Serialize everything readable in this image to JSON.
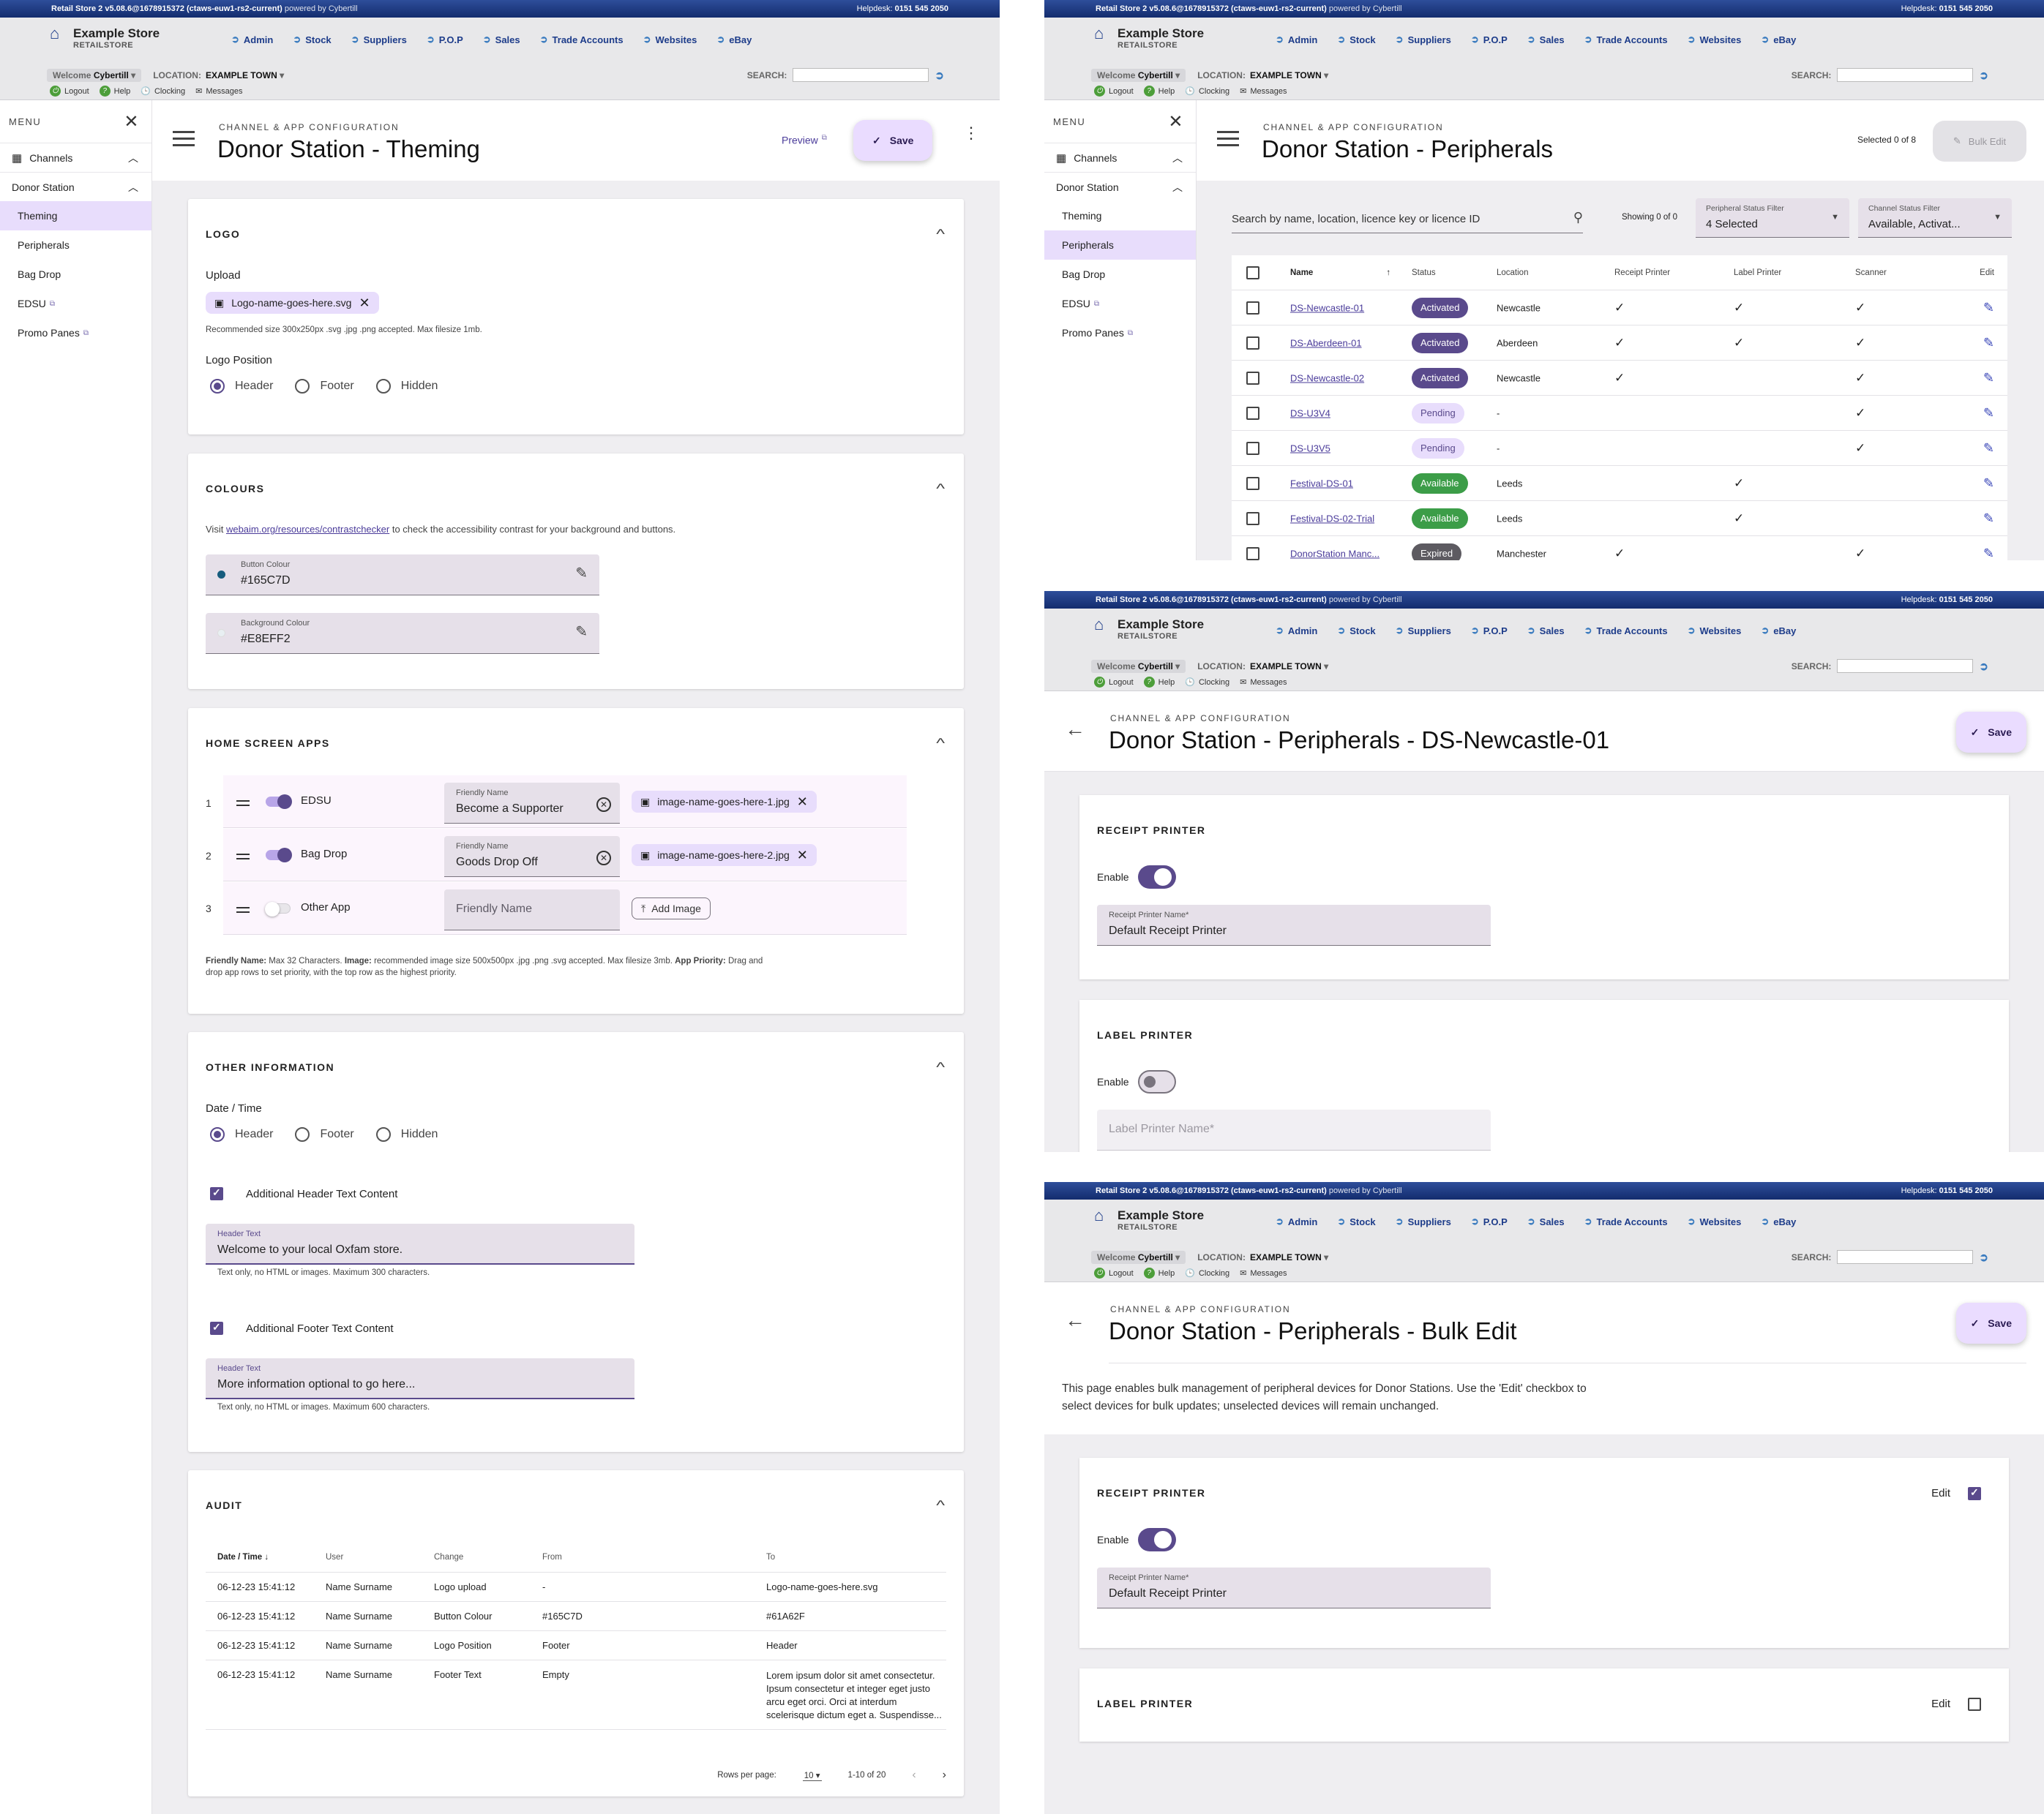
{
  "legacy": {
    "version": "Retail Store 2 v5.08.6@1678915372 (ctaws-euw1-rs2-current)",
    "powered": "powered by Cybertill",
    "helpdesk_label": "Helpdesk:",
    "helpdesk": "0151 545 2050",
    "store": "Example Store",
    "store_sub": "RETAILSTORE",
    "nav": [
      "Admin",
      "Stock",
      "Suppliers",
      "P.O.P",
      "Sales",
      "Trade Accounts",
      "Websites",
      "eBay"
    ],
    "welcome": "Welcome",
    "user": "Cybertill",
    "location_label": "LOCATION:",
    "location": "EXAMPLE TOWN",
    "search_label": "SEARCH:",
    "links": [
      "Logout",
      "Help",
      "Clocking",
      "Messages"
    ]
  },
  "menu": {
    "title": "MENU",
    "channels": "Channels",
    "donor_station": "Donor Station",
    "items": [
      "Theming",
      "Peripherals",
      "Bag Drop",
      "EDSU",
      "Promo Panes"
    ]
  },
  "common": {
    "kicker": "CHANNEL & APP CONFIGURATION",
    "save": "Save",
    "preview": "Preview"
  },
  "theming": {
    "title": "Donor Station - Theming",
    "logo": {
      "heading": "LOGO",
      "upload_label": "Upload",
      "file": "Logo-name-goes-here.svg",
      "hint": "Recommended size 300x250px .svg .jpg .png accepted. Max filesize 1mb.",
      "position_label": "Logo Position",
      "options": [
        "Header",
        "Footer",
        "Hidden"
      ],
      "selected": "Header"
    },
    "colours": {
      "heading": "COLOURS",
      "visit": "Visit",
      "link": "webaim.org/resources/contrastchecker",
      "visit_rest": "to check the accessibility contrast for your background and buttons.",
      "button_label": "Button Colour",
      "button_value": "#165C7D",
      "bg_label": "Background Colour",
      "bg_value": "#E8EFF2"
    },
    "apps": {
      "heading": "HOME SCREEN APPS",
      "friendly_label": "Friendly Name",
      "rows": [
        {
          "num": "1",
          "name": "EDSU",
          "friendly": "Become a Supporter",
          "image": "image-name-goes-here-1.jpg",
          "enabled": true
        },
        {
          "num": "2",
          "name": "Bag Drop",
          "friendly": "Goods Drop Off",
          "image": "image-name-goes-here-2.jpg",
          "enabled": true
        },
        {
          "num": "3",
          "name": "Other App",
          "friendly_placeholder": "Friendly Name",
          "add_image": "Add Image",
          "enabled": false
        }
      ],
      "note_b1": "Friendly Name:",
      "note_t1": " Max 32 Characters. ",
      "note_b2": "Image:",
      "note_t2": " recommended image size 500x500px .jpg .png .svg accepted. Max filesize 3mb. ",
      "note_b3": "App Priority:",
      "note_t3": " Drag and",
      "note_line2": "drop app rows to set priority, with the top row as the highest priority."
    },
    "other": {
      "heading": "OTHER INFORMATION",
      "datetime_label": "Date / Time",
      "options": [
        "Header",
        "Footer",
        "Hidden"
      ],
      "header_check": "Additional Header Text Content",
      "header_field_label": "Header Text",
      "header_value": "Welcome to your local Oxfam store.",
      "header_hint": "Text only, no HTML or images. Maximum 300 characters.",
      "footer_check": "Additional Footer Text Content",
      "footer_field_label": "Header Text",
      "footer_value": "More information optional to go here...",
      "footer_hint": "Text only, no HTML or images. Maximum 600 characters."
    },
    "audit": {
      "heading": "AUDIT",
      "columns": [
        "Date / Time",
        "User",
        "Change",
        "From",
        "To"
      ],
      "rows": [
        [
          "06-12-23 15:41:12",
          "Name Surname",
          "Logo upload",
          "-",
          "Logo-name-goes-here.svg"
        ],
        [
          "06-12-23 15:41:12",
          "Name Surname",
          "Button Colour",
          "#165C7D",
          "#61A62F"
        ],
        [
          "06-12-23 15:41:12",
          "Name Surname",
          "Logo Position",
          "Footer",
          "Header"
        ],
        [
          "06-12-23 15:41:12",
          "Name Surname",
          "Footer Text",
          "Empty",
          "Lorem ipsum dolor sit amet consectetur. Ipsum consectetur et integer eget justo arcu eget orci. Orci at interdum scelerisque dictum eget a. Suspendisse..."
        ]
      ],
      "rows_per_page_label": "Rows per page:",
      "rows_per_page": "10",
      "range": "1-10 of 20"
    }
  },
  "peripherals": {
    "title": "Donor Station - Peripherals",
    "selected": "Selected 0 of 8",
    "bulk_edit": "Bulk Edit",
    "search_placeholder": "Search by name, location, licence key or licence ID",
    "showing": "Showing 0 of 0",
    "filter1_label": "Peripheral Status Filter",
    "filter1_value": "4 Selected",
    "filter2_label": "Channel Status Filter",
    "filter2_value": "Available, Activat...",
    "columns": [
      "Name",
      "Status",
      "Location",
      "Receipt Printer",
      "Label Printer",
      "Scanner",
      "Edit"
    ],
    "rows": [
      {
        "name": "DS-Newcastle-01",
        "status": "Activated",
        "location": "Newcastle",
        "rp": "✓",
        "lp": "✓",
        "sc": "✓"
      },
      {
        "name": "DS-Aberdeen-01",
        "status": "Activated",
        "location": "Aberdeen",
        "rp": "✓",
        "lp": "✓",
        "sc": "✓"
      },
      {
        "name": "DS-Newcastle-02",
        "status": "Activated",
        "location": "Newcastle",
        "rp": "✓",
        "lp": "",
        "sc": "✓"
      },
      {
        "name": "DS-U3V4",
        "status": "Pending",
        "location": "-",
        "rp": "",
        "lp": "",
        "sc": "✓"
      },
      {
        "name": "DS-U3V5",
        "status": "Pending",
        "location": "-",
        "rp": "",
        "lp": "",
        "sc": "✓"
      },
      {
        "name": "Festival-DS-01",
        "status": "Available",
        "location": "Leeds",
        "rp": "",
        "lp": "✓",
        "sc": ""
      },
      {
        "name": "Festival-DS-02-Trial",
        "status": "Available",
        "location": "Leeds",
        "rp": "",
        "lp": "✓",
        "sc": ""
      },
      {
        "name": "DonorStation Manc...",
        "status": "Expired",
        "location": "Manchester",
        "rp": "✓",
        "lp": "",
        "sc": "✓"
      }
    ]
  },
  "device": {
    "title": "Donor Station - Peripherals - DS-Newcastle-01",
    "receipt_heading": "RECEIPT PRINTER",
    "enable": "Enable",
    "receipt_label": "Receipt Printer Name*",
    "receipt_value": "Default Receipt Printer",
    "label_heading": "LABEL PRINTER",
    "label_placeholder": "Label Printer Name*"
  },
  "bulk": {
    "title": "Donor Station - Peripherals - Bulk Edit",
    "desc1": "This page enables bulk management of peripheral devices for Donor Stations. Use the 'Edit' checkbox to",
    "desc2": "select devices for bulk updates; unselected devices will remain unchanged.",
    "receipt_heading": "RECEIPT PRINTER",
    "label_heading": "LABEL PRINTER",
    "edit": "Edit",
    "enable": "Enable",
    "receipt_label": "Receipt Printer Name*",
    "receipt_value": "Default Receipt Printer"
  },
  "colors": {
    "accent": "#5A4A8C",
    "accent_light": "#E8DDFC",
    "button_swatch": "#165C7D",
    "bg_swatch": "#E8EFF2"
  }
}
